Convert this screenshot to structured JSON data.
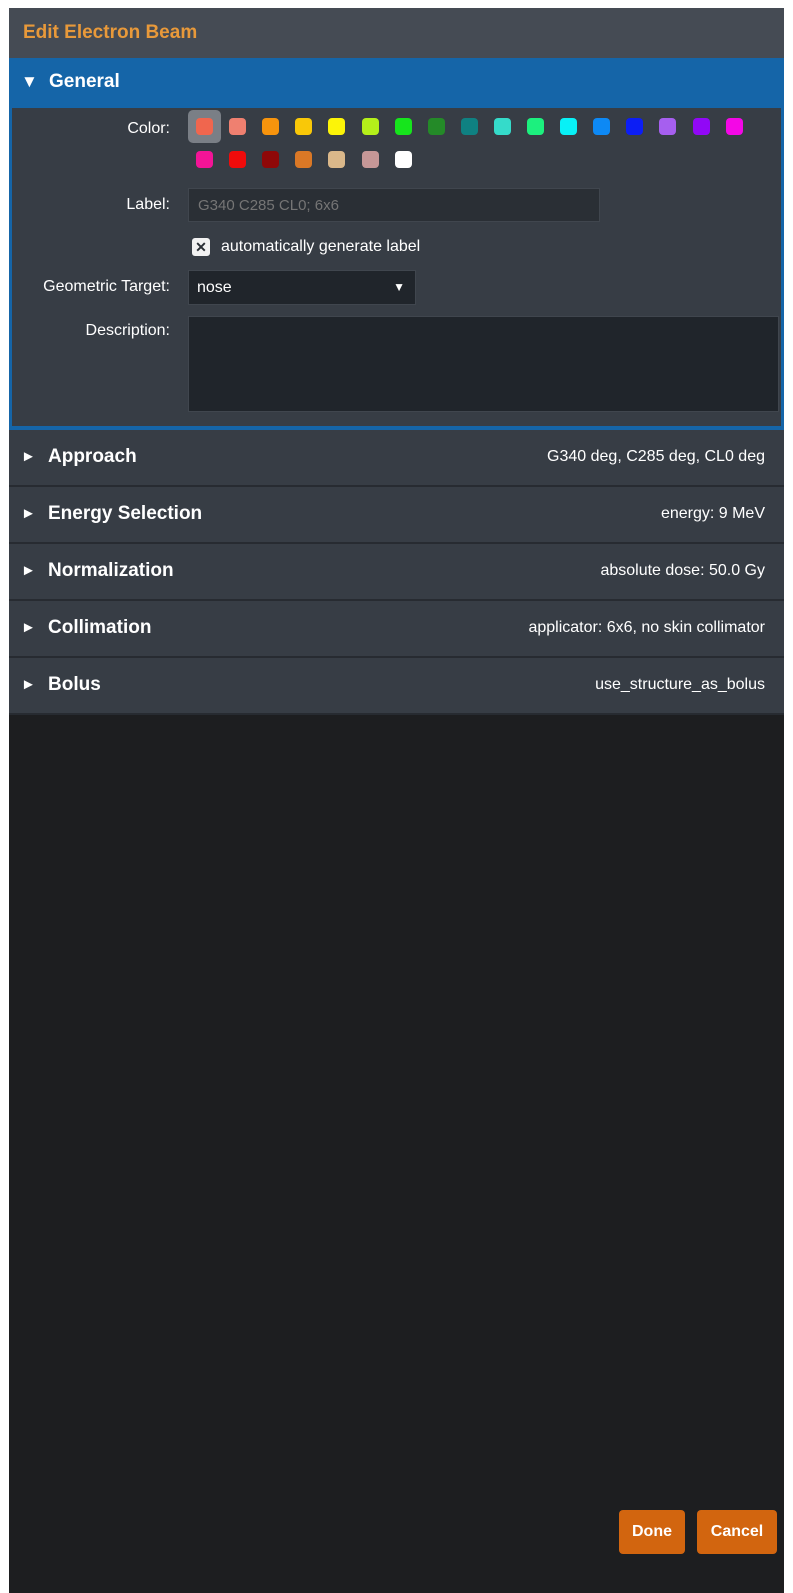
{
  "window": {
    "title": "Edit Electron Beam"
  },
  "general": {
    "header": "General",
    "expand_icon": "triangle-down-icon",
    "color_label": "Color:",
    "colors": [
      "#f0664e",
      "#ef8070",
      "#f7940d",
      "#f9c808",
      "#fcf408",
      "#b4f01a",
      "#16e51c",
      "#248a28",
      "#0f8182",
      "#35dbca",
      "#1cf07e",
      "#08f1f6",
      "#0d89f5",
      "#0c1ef5",
      "#a65fef",
      "#9108f6",
      "#f407e6",
      "#f31497",
      "#f00b0b",
      "#8f0808",
      "#da7826",
      "#dab88a",
      "#c69797",
      "#ffffff"
    ],
    "selected_color": "#f0664e",
    "label_label": "Label:",
    "label_value": "G340 C285 CL0; 6x6",
    "auto_label_text": "automatically generate label",
    "auto_label_checked": true,
    "check_glyph": "✕",
    "target_label": "Geometric Target:",
    "target_value": "nose",
    "target_caret": "▼",
    "description_label": "Description:",
    "description_value": ""
  },
  "sections": [
    {
      "name": "Approach",
      "summary": "G340 deg, C285 deg, CL0 deg",
      "icon": "triangle-right-icon"
    },
    {
      "name": "Energy Selection",
      "summary": "energy: 9 MeV",
      "icon": "triangle-right-icon"
    },
    {
      "name": "Normalization",
      "summary": "absolute dose: 50.0 Gy",
      "icon": "triangle-right-icon"
    },
    {
      "name": "Collimation",
      "summary": "applicator: 6x6, no skin collimator",
      "icon": "triangle-right-icon"
    },
    {
      "name": "Bolus",
      "summary": "use_structure_as_bolus",
      "icon": "triangle-right-icon"
    }
  ],
  "glyphs": {
    "collapsed": "►",
    "expanded": "▼"
  },
  "buttons": {
    "done": "Done",
    "cancel": "Cancel"
  },
  "theme": {
    "accent": "#1565a8",
    "title_text": "#e8993a",
    "button": "#d2650f"
  }
}
